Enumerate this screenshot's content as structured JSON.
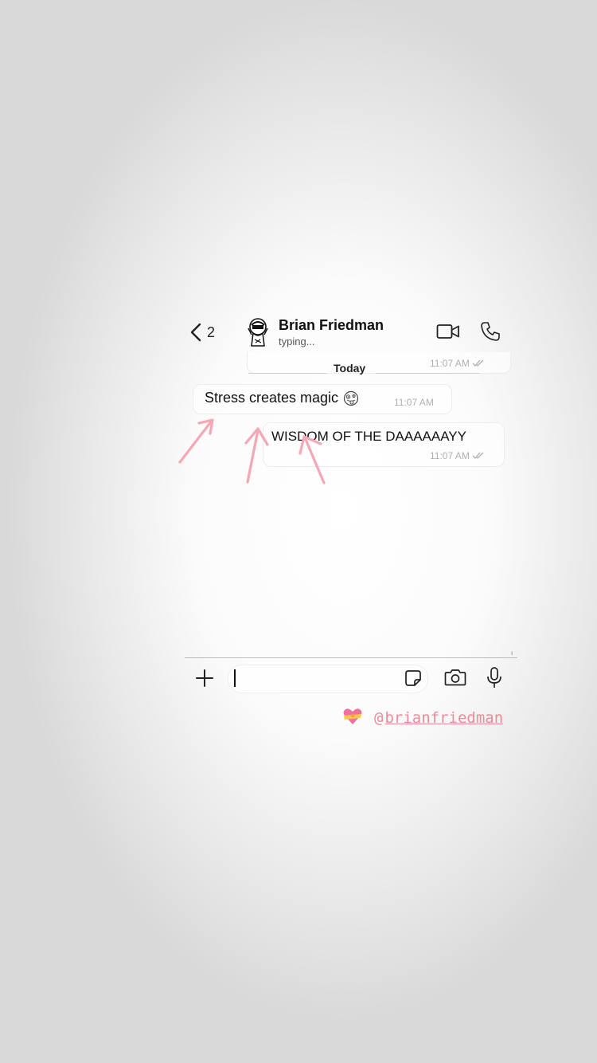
{
  "header": {
    "back_count": "2",
    "contact_name": "Brian Friedman",
    "contact_status": "typing..."
  },
  "chat": {
    "date_label": "Today",
    "messages": [
      {
        "direction": "out",
        "text": "",
        "time": "11:07 AM",
        "read": true
      },
      {
        "direction": "in",
        "text": "Stress creates magic",
        "emoji": "zany-face",
        "time": "11:07 AM"
      },
      {
        "direction": "out",
        "text": "WISDOM OF THE DAAAAAAYY",
        "time": "11:07 AM",
        "read": true
      }
    ]
  },
  "input_bar": {
    "divider_mark": "ı"
  },
  "annotation": {
    "arrow_color": "#f4a7b4",
    "arrow_count": 3
  },
  "mention": {
    "at": "@",
    "handle": "brianfriedman",
    "color": "#ef8a98",
    "emoji": "heart-with-ribbon"
  }
}
